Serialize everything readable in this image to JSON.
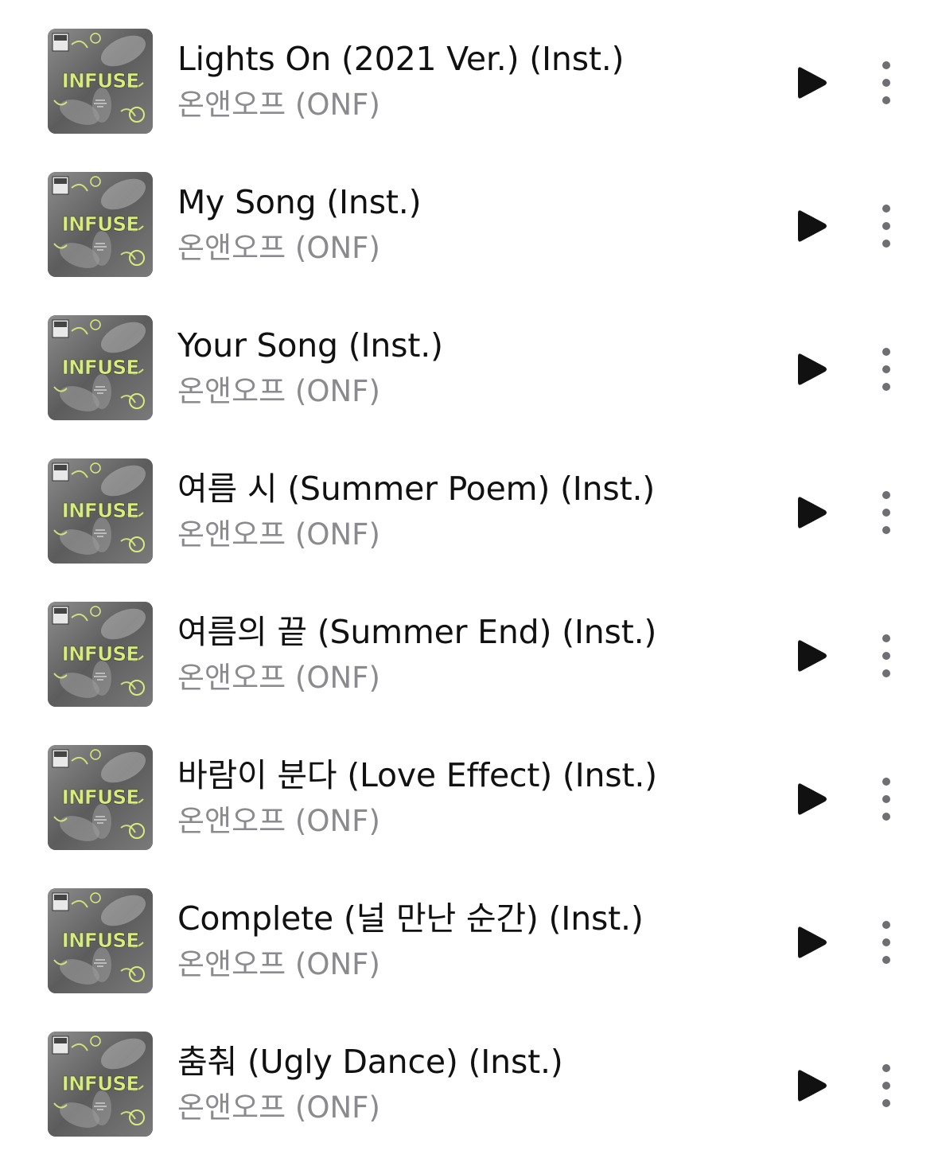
{
  "tracks": [
    {
      "title": "Lights On (2021 Ver.) (Inst.)",
      "artist": "온앤오프 (ONF)",
      "art_text": "INFUSE"
    },
    {
      "title": "My Song (Inst.)",
      "artist": "온앤오프 (ONF)",
      "art_text": "INFUSE"
    },
    {
      "title": "Your Song (Inst.)",
      "artist": "온앤오프 (ONF)",
      "art_text": "INFUSE"
    },
    {
      "title": "여름 시 (Summer Poem) (Inst.)",
      "artist": "온앤오프 (ONF)",
      "art_text": "INFUSE"
    },
    {
      "title": "여름의 끝 (Summer End) (Inst.)",
      "artist": "온앤오프 (ONF)",
      "art_text": "INFUSE"
    },
    {
      "title": "바람이 분다 (Love Effect) (Inst.)",
      "artist": "온앤오프 (ONF)",
      "art_text": "INFUSE"
    },
    {
      "title": "Complete (널 만난 순간) (Inst.)",
      "artist": "온앤오프 (ONF)",
      "art_text": "INFUSE"
    },
    {
      "title": "춤춰 (Ugly Dance) (Inst.)",
      "artist": "온앤오프 (ONF)",
      "art_text": "INFUSE"
    }
  ],
  "icons": {
    "play": "play-icon",
    "more": "more-vertical-icon",
    "art": "album-art"
  },
  "colors": {
    "title": "#111111",
    "artist": "#8a8a8f",
    "icon": "#111111",
    "more_dots": "#6e6e73",
    "art_accent": "#d8ec7c"
  }
}
